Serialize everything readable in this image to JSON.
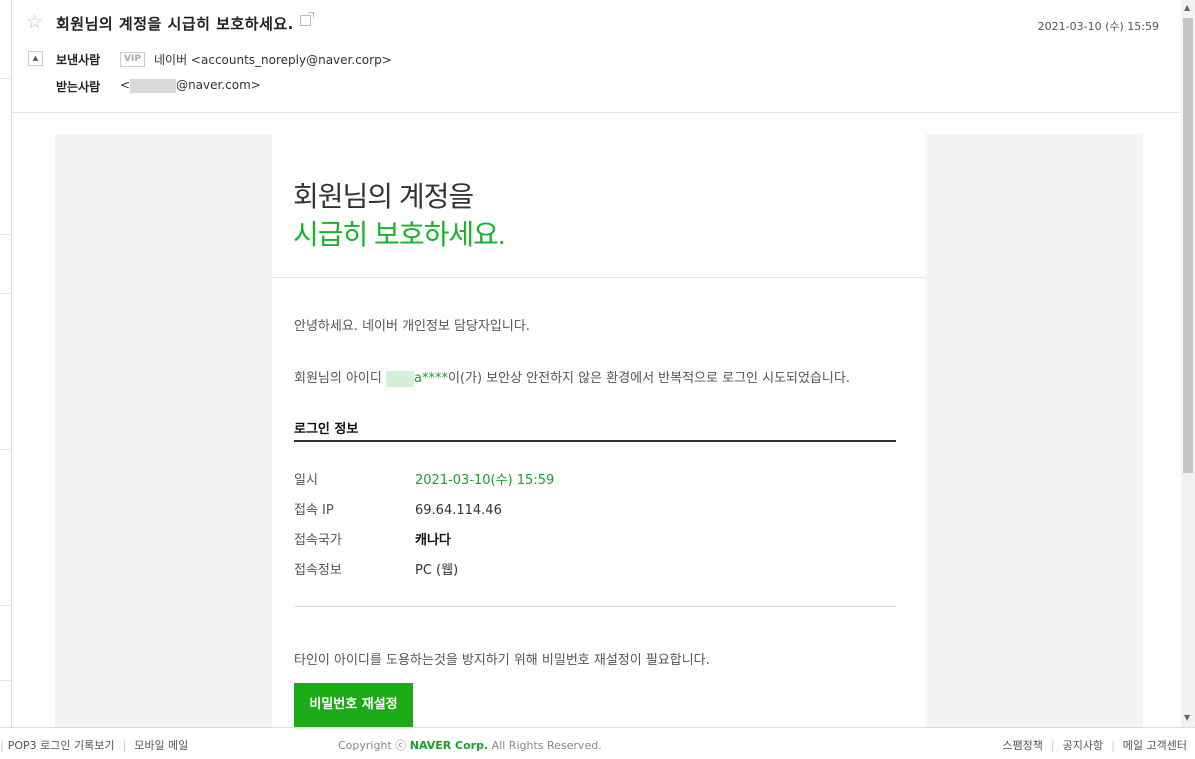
{
  "email": {
    "subject": "회원님의 계정을 시급히 보호하세요.",
    "date": "2021-03-10 (수) 15:59",
    "sender_label": "보낸사람",
    "vip_badge": "VIP",
    "sender": "네이버 <accounts_noreply@naver.corp>",
    "recipient_label": "받는사람",
    "recipient_prefix": "<",
    "recipient_suffix": "@naver.com>"
  },
  "body": {
    "title_line1": "회원님의 계정을",
    "title_line2": "시급히 보호하세요.",
    "greeting": "안녕하세요. 네이버 개인정보 담당자입니다.",
    "notice_prefix": "회원님의 아이디 ",
    "notice_masked": "a****",
    "notice_suffix": "이(가) 보안상 안전하지 않은 환경에서 반복적으로 로그인 시도되었습니다.",
    "section_title": "로그인 정보",
    "login_info": [
      {
        "key": "일시",
        "value": "2021-03-10(수) 15:59"
      },
      {
        "key": "접속 IP",
        "value": "69.64.114.46"
      },
      {
        "key": "접속국가",
        "value": "캐나다"
      },
      {
        "key": "접속정보",
        "value": "PC (웹)"
      }
    ],
    "advice": "타인이 아이디를 도용하는것을 방지하기 위해 비밀번호 재설정이 필요합니다.",
    "button_label": "비밀번호 재설정"
  },
  "footer": {
    "pop3": "POP3 로그인 기록보기",
    "mobile": "모바일 메일",
    "copyright_prefix": "Copyright ⓒ ",
    "brand": "NAVER Corp.",
    "copyright_suffix": " All Rights Reserved.",
    "spam": "스팸정책",
    "notice": "공지사항",
    "support": "메일 고객센터"
  },
  "colors": {
    "accent": "#19b42b",
    "button": "#1aab16"
  }
}
